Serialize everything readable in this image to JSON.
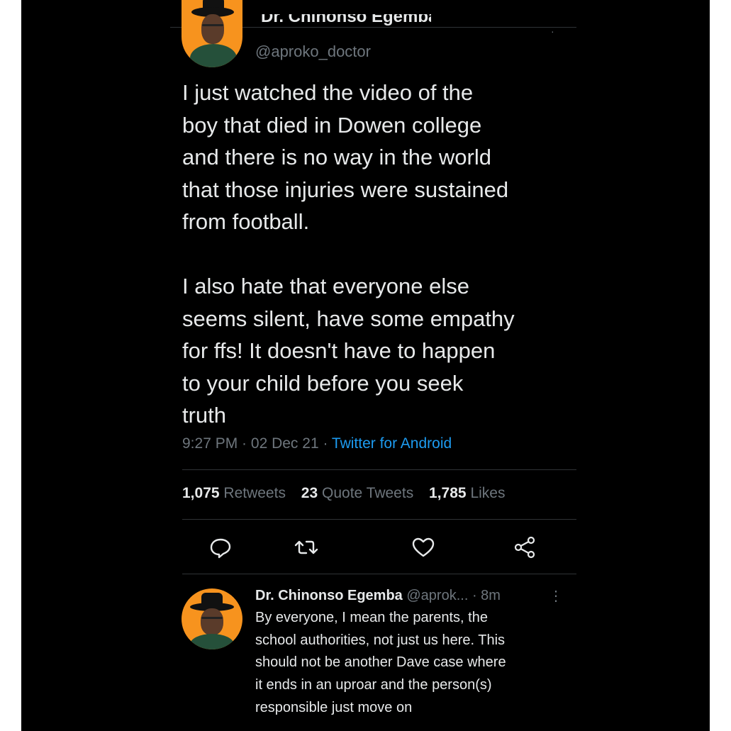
{
  "tweet": {
    "display_name_cut": "Dr. Chinonso Egemba",
    "handle": "@aproko_doctor",
    "text": "I just watched the video of the\nboy that died in Dowen college\nand there is no way in the world\nthat those injuries were sustained\nfrom football.\n\nI also hate that everyone else\nseems silent, have some empathy\nfor ffs! It doesn't have to happen\nto your child before you seek\ntruth",
    "time": "9:27 PM",
    "date": "02 Dec 21",
    "sep": " · ",
    "source": "Twitter for Android"
  },
  "stats": {
    "retweets_count": "1,075",
    "retweets_label": "Retweets",
    "quotes_count": "23",
    "quotes_label": "Quote Tweets",
    "likes_count": "1,785",
    "likes_label": "Likes"
  },
  "actions": {
    "reply_icon": "reply-icon",
    "retweet_icon": "retweet-icon",
    "like_icon": "like-icon",
    "share_icon": "share-icon"
  },
  "reply": {
    "name": "Dr. Chinonso Egemba",
    "handle": "@aprok...",
    "time": "· 8m",
    "more": "⋮",
    "text": "By everyone, I mean the parents, the\nschool authorities, not just us here. This\nshould not be another Dave case where\nit ends in an uproar and the person(s)\nresponsible just move on"
  },
  "colors": {
    "background": "#000000",
    "text": "#e7e9ea",
    "secondary": "#6e767d",
    "link": "#1d9bf0",
    "avatar_bg": "#f7931e"
  }
}
